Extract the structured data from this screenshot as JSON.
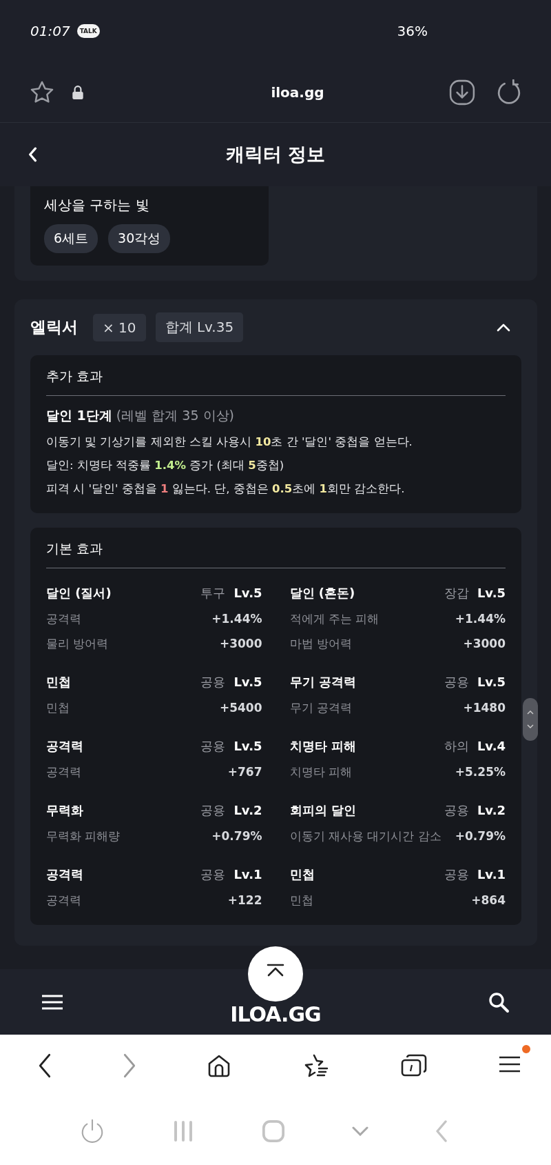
{
  "status_bar": {
    "time": "01:07",
    "talk_badge": "TALK",
    "battery": "36%"
  },
  "browser": {
    "url": "iloa.gg"
  },
  "header": {
    "title": "캐릭터 정보"
  },
  "set_card": {
    "name": "세상을 구하는 빛",
    "chips": [
      "6세트",
      "30각성"
    ]
  },
  "elixir": {
    "title": "엘릭서",
    "chips": [
      "× 10",
      "합계 Lv.35"
    ],
    "expanded": true,
    "extra": {
      "title": "추가 효과",
      "tier": "달인 1단계",
      "condition": "(레벨 합계 35 이상)",
      "lines": [
        [
          {
            "text": "이동기 및 기상기를 제외한 스킬 사용시 "
          },
          {
            "text": "10",
            "color": "#f3e9a0"
          },
          {
            "text": "초 간 '달인' 중첩을 얻는다."
          }
        ],
        [
          {
            "text": "달인: 치명타 적중률 "
          },
          {
            "text": "1.4%",
            "color": "#c3ef8e"
          },
          {
            "text": " 증가 (최대 "
          },
          {
            "text": "5",
            "color": "#f3e9a0"
          },
          {
            "text": "중첩)"
          }
        ],
        [
          {
            "text": "피격 시 '달인' 중첩을 "
          },
          {
            "text": "1",
            "color": "#ef7f7f"
          },
          {
            "text": " 잃는다. 단, 중첩은 "
          },
          {
            "text": "0.5",
            "color": "#f3e9a0"
          },
          {
            "text": "초에 "
          },
          {
            "text": "1",
            "color": "#f3e9a0"
          },
          {
            "text": "회만 감소한다."
          }
        ]
      ]
    },
    "basic": {
      "title": "기본 효과",
      "entries": [
        {
          "name": "달인 (질서)",
          "slot": "투구",
          "level": "Lv.5",
          "stats": [
            {
              "label": "공격력",
              "value": "+1.44%"
            },
            {
              "label": "물리 방어력",
              "value": "+3000"
            }
          ]
        },
        {
          "name": "달인 (혼돈)",
          "slot": "장갑",
          "level": "Lv.5",
          "stats": [
            {
              "label": "적에게 주는 피해",
              "value": "+1.44%"
            },
            {
              "label": "마법 방어력",
              "value": "+3000"
            }
          ]
        },
        {
          "name": "민첩",
          "slot": "공용",
          "level": "Lv.5",
          "stats": [
            {
              "label": "민첩",
              "value": "+5400"
            }
          ]
        },
        {
          "name": "무기 공격력",
          "slot": "공용",
          "level": "Lv.5",
          "stats": [
            {
              "label": "무기 공격력",
              "value": "+1480"
            }
          ]
        },
        {
          "name": "공격력",
          "slot": "공용",
          "level": "Lv.5",
          "stats": [
            {
              "label": "공격력",
              "value": "+767"
            }
          ]
        },
        {
          "name": "치명타 피해",
          "slot": "하의",
          "level": "Lv.4",
          "stats": [
            {
              "label": "치명타 피해",
              "value": "+5.25%"
            }
          ]
        },
        {
          "name": "무력화",
          "slot": "공용",
          "level": "Lv.2",
          "stats": [
            {
              "label": "무력화 피해량",
              "value": "+0.79%"
            }
          ]
        },
        {
          "name": "회피의 달인",
          "slot": "공용",
          "level": "Lv.2",
          "stats": [
            {
              "label": "이동기 재사용 대기시간 감소",
              "value": "+0.79%"
            }
          ]
        },
        {
          "name": "공격력",
          "slot": "공용",
          "level": "Lv.1",
          "stats": [
            {
              "label": "공격력",
              "value": "+122"
            }
          ]
        },
        {
          "name": "민첩",
          "slot": "공용",
          "level": "Lv.1",
          "stats": [
            {
              "label": "민첩",
              "value": "+864"
            }
          ]
        }
      ]
    }
  },
  "site_nav": {
    "logo": "ILOA.GG"
  },
  "toolbar": {
    "back_disabled": false,
    "forward_disabled": true
  }
}
